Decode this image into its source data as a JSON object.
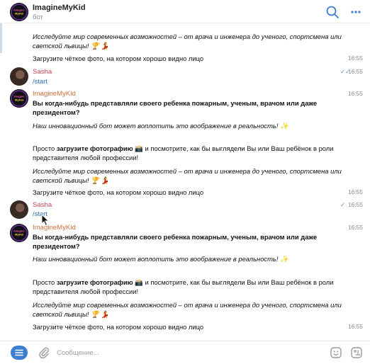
{
  "header": {
    "title": "ImagineMyKid",
    "subtitle": "бот",
    "avatar_text": "ImagineMyKid"
  },
  "colors": {
    "accent": "#3c7fd0",
    "user_name": "#c6475a",
    "bot_name": "#d4703b",
    "link": "#2d6fb5",
    "time": "#8a8a8a"
  },
  "top_fragment": {
    "explore_1": "Исследуйте мир современных возможностей – от врача и инженера до ученого, спортсмена или",
    "explore_2": "светской львицы! 🏆 💃",
    "upload": "Загрузите чёткое фото, на котором хорошо видно лицо",
    "time": "16:55"
  },
  "msg_user_1": {
    "sender": "Sasha",
    "text": "/start",
    "check": "✓✓",
    "time": "16:55"
  },
  "msg_bot_1": {
    "sender": "ImagineMyKid",
    "q1": "Вы когда-нибудь представляли своего ребенка пожарным, ученым, врачом или даже",
    "q2": "президентом?",
    "innovative": "Наш инновационный бот может воплотить это воображение в реальность! ✨",
    "try_1_pre": "Просто ",
    "try_1_bold": "загрузите фотографию",
    "try_1_post": " 📸 и посмотрите, как бы выглядели Вы или Ваш ребёнок в роли",
    "try_2": "представителя любой профессии!",
    "explore_1": "Исследуйте мир современных возможностей – от врача и инженера до ученого, спортсмена или",
    "explore_2": "светской львицы! 🏆 💃",
    "upload": "Загрузите чёткое фото, на котором хорошо видно лицо",
    "time": "16:55"
  },
  "msg_user_2": {
    "sender": "Sasha",
    "text": "/start",
    "check": "✓",
    "time": "16:55"
  },
  "msg_bot_2": {
    "sender": "ImagineMyKid",
    "q1": "Вы когда-нибудь представляли своего ребенка пожарным, ученым, врачом или даже",
    "q2": "президентом?",
    "innovative": "Наш инновационный бот может воплотить это воображение в реальность! ✨",
    "try_1_pre": "Просто ",
    "try_1_bold": "загрузите фотографию",
    "try_1_post": " 📸 и посмотрите, как бы выглядели Вы или Ваш ребёнок в роли",
    "try_2": "представителя любой профессии!",
    "explore_1": "Исследуйте мир современных возможностей – от врача и инженера до ученого, спортсмена или",
    "explore_2": "светской львицы! 🏆 💃",
    "upload": "Загрузите чёткое фото, на котором хорошо видно лицо",
    "time": "16:55"
  },
  "composer": {
    "placeholder": "Сообщение..."
  },
  "icons": {
    "search": "search-icon",
    "more": "more-icon",
    "menu": "menu-icon",
    "attach": "paperclip-icon",
    "sticker": "sticker-icon",
    "bot_commands": "bot-commands-icon"
  }
}
